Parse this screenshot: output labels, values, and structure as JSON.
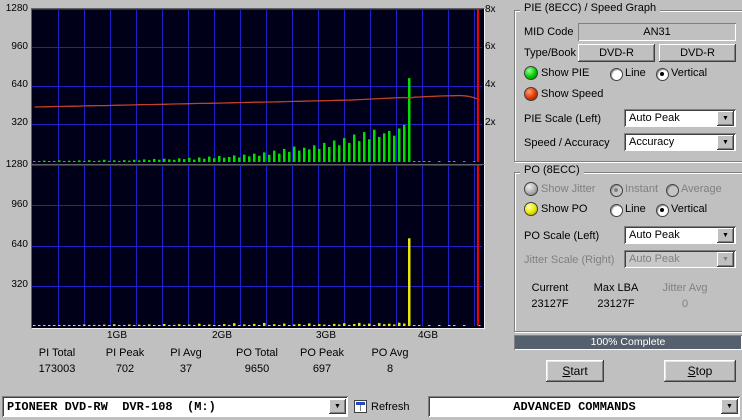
{
  "colors": {
    "window_bg": "#c0c0c0",
    "progress_bg": "#565f6d",
    "disabled_text": "#808080"
  },
  "led_colors": {
    "green": {
      "hi": "#9cff9c",
      "mid": "#00cc00",
      "lo": "#006600"
    },
    "red": {
      "hi": "#ff9c70",
      "mid": "#e03800",
      "lo": "#7a1c00"
    },
    "yellow": {
      "hi": "#ffffb0",
      "mid": "#e8e800",
      "lo": "#8f8f00"
    },
    "gray": {
      "hi": "#f0f0f0",
      "mid": "#b0b0b0",
      "lo": "#707070"
    }
  },
  "chart_data": {
    "type": "bar",
    "title": "PIE (8ECC) / Speed Graph and PO (8ECC) scan of DVD-R",
    "x_axis": {
      "labels": [
        "1GB",
        "2GB",
        "3GB",
        "4GB"
      ],
      "unit": "GB"
    },
    "y_axis_left": {
      "labels": [
        "1280",
        "960",
        "640",
        "320"
      ],
      "max": 1280
    },
    "y_axis_right": {
      "labels": [
        "8x",
        "6x",
        "4x",
        "2x"
      ],
      "note": "speed axis, 8x aligns with 1280"
    },
    "colors": {
      "bg": "#000018",
      "grid": "#2020c8",
      "marker": "#ff0000"
    },
    "marker_x_fraction": 0.991,
    "pie_series": {
      "type": "bar",
      "name": "PIE errors",
      "color": "#00dd00",
      "values": [
        8,
        5,
        12,
        6,
        9,
        14,
        7,
        11,
        6,
        13,
        9,
        15,
        8,
        12,
        18,
        10,
        14,
        9,
        16,
        12,
        18,
        14,
        22,
        16,
        25,
        19,
        28,
        22,
        18,
        30,
        24,
        35,
        20,
        38,
        28,
        45,
        32,
        50,
        36,
        42,
        55,
        38,
        62,
        48,
        70,
        52,
        80,
        60,
        95,
        70,
        110,
        85,
        130,
        95,
        120,
        105,
        140,
        110,
        160,
        125,
        180,
        140,
        200,
        160,
        230,
        175,
        250,
        190,
        270,
        210,
        240,
        260,
        220,
        280,
        310,
        702,
        3,
        1,
        2,
        1,
        0,
        1,
        0,
        2,
        1,
        0,
        1,
        0,
        1,
        0
      ]
    },
    "speed_series": {
      "type": "line",
      "name": "Read speed",
      "color": "#c04028",
      "values": [
        460,
        461,
        462,
        463,
        464,
        464,
        465,
        466,
        467,
        468,
        469,
        470,
        471,
        472,
        472,
        473,
        474,
        475,
        476,
        477,
        478,
        479,
        480,
        480,
        481,
        482,
        483,
        484,
        485,
        486,
        487,
        488,
        489,
        490,
        490,
        491,
        492,
        493,
        494,
        495,
        496,
        497,
        498,
        499,
        500,
        500,
        501,
        502,
        503,
        504,
        505,
        506,
        507,
        508,
        509,
        510,
        511,
        512,
        513,
        514,
        515,
        516,
        517,
        518,
        520,
        522,
        524,
        526,
        528,
        530,
        532,
        534,
        536,
        538,
        540,
        535,
        542,
        544,
        546,
        548,
        550,
        552,
        553,
        554,
        555,
        556,
        554,
        548,
        536,
        520
      ]
    },
    "po_series": {
      "type": "bar",
      "name": "PO errors",
      "color": "#e6e600",
      "values": [
        4,
        2,
        6,
        3,
        5,
        8,
        3,
        6,
        2,
        7,
        12,
        5,
        9,
        4,
        11,
        6,
        14,
        5,
        8,
        12,
        6,
        10,
        4,
        13,
        7,
        5,
        16,
        6,
        9,
        14,
        5,
        11,
        7,
        18,
        6,
        12,
        8,
        5,
        15,
        9,
        22,
        7,
        13,
        5,
        17,
        9,
        25,
        8,
        14,
        6,
        19,
        8,
        12,
        16,
        7,
        21,
        9,
        15,
        11,
        8,
        17,
        12,
        22,
        9,
        16,
        25,
        11,
        19,
        8,
        23,
        14,
        18,
        12,
        26,
        20,
        697,
        2,
        1,
        0,
        1,
        0,
        2,
        0,
        1,
        1,
        0,
        1,
        0,
        0,
        1
      ]
    }
  },
  "stats": {
    "headers": [
      "PI Total",
      "PI Peak",
      "PI Avg",
      "PO Total",
      "PO Peak",
      "PO Avg"
    ],
    "values": [
      "173003",
      "702",
      "37",
      "9650",
      "697",
      "8"
    ]
  },
  "device_bar": {
    "drive": "PIONEER DVD-RW  DVR-108  (M:)",
    "refresh_label": "Refresh",
    "advanced_label": "ADVANCED COMMANDS"
  },
  "pie_panel": {
    "title": "PIE (8ECC) / Speed Graph",
    "mid_code_label": "MID Code",
    "mid_code_value": "AN31",
    "type_book_label": "Type/Book",
    "type_value": "DVD-R",
    "book_value": "DVD-R",
    "show_pie_label": "Show PIE",
    "show_speed_label": "Show Speed",
    "line_label": "Line",
    "vertical_label": "Vertical",
    "pie_scale_label": "PIE Scale (Left)",
    "pie_scale_value": "Auto Peak",
    "speed_accuracy_label": "Speed / Accuracy",
    "speed_accuracy_value": "Accuracy"
  },
  "po_panel": {
    "title": "PO (8ECC)",
    "show_jitter_label": "Show Jitter",
    "instant_label": "Instant",
    "average_label": "Average",
    "show_po_label": "Show PO",
    "line_label": "Line",
    "vertical_label": "Vertical",
    "po_scale_label": "PO Scale (Left)",
    "po_scale_value": "Auto Peak",
    "jitter_scale_label": "Jitter Scale (Right)",
    "jitter_scale_value": "Auto Peak",
    "current_label": "Current",
    "current_value": "23127F",
    "max_lba_label": "Max LBA",
    "max_lba_value": "23127F",
    "jitter_avg_label": "Jitter Avg",
    "jitter_avg_value": "0"
  },
  "progress": {
    "label": "100% Complete",
    "percent": 100
  },
  "buttons": {
    "start_label": "Start",
    "stop_label": "Stop"
  }
}
